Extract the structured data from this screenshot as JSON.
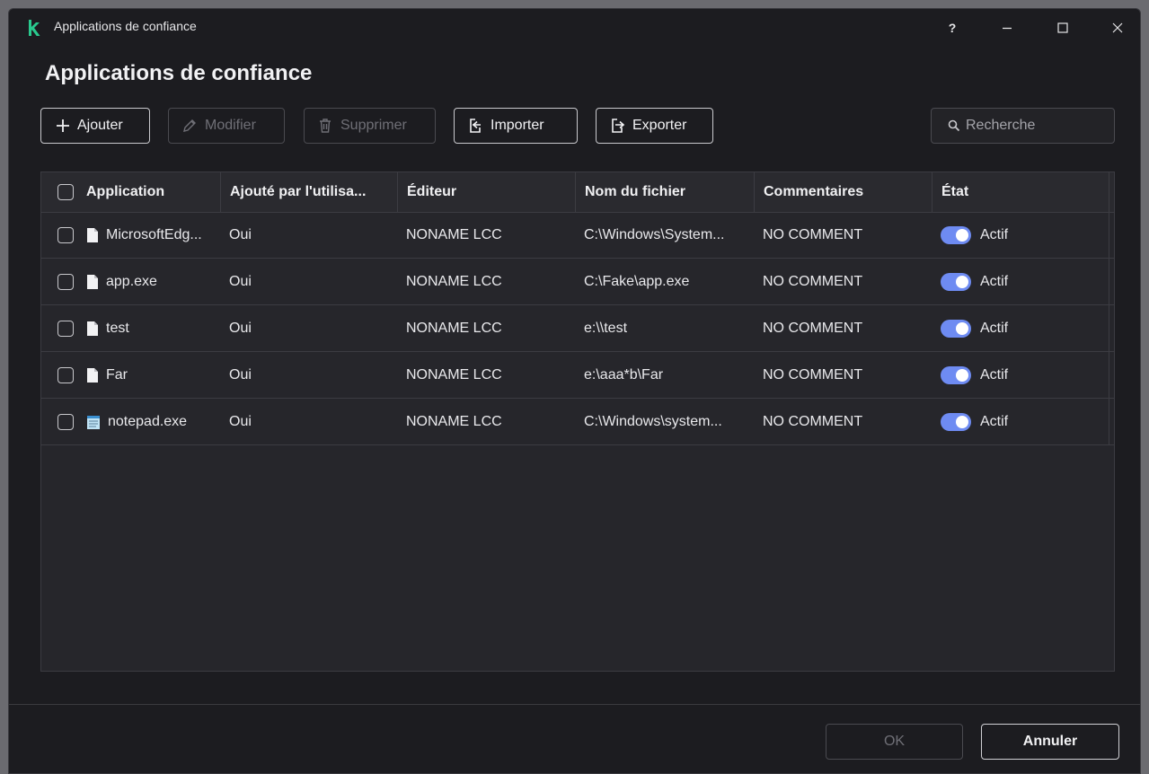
{
  "window": {
    "title": "Applications de confiance",
    "help": "?",
    "minimize": "—",
    "maximize": "☐",
    "close": "✕"
  },
  "page": {
    "title": "Applications de confiance"
  },
  "toolbar": {
    "add": "Ajouter",
    "edit": "Modifier",
    "delete": "Supprimer",
    "import": "Importer",
    "export": "Exporter",
    "search_placeholder": "Recherche"
  },
  "table": {
    "headers": [
      "Application",
      "Ajouté par l'utilisa...",
      "Éditeur",
      "Nom du fichier",
      "Commentaires",
      "État"
    ],
    "rows": [
      {
        "app": "MicrosoftEdg...",
        "added": "Oui",
        "publisher": "NONAME LCC",
        "file": "C:\\Windows\\System...",
        "comment": "NO COMMENT",
        "state": "Actif",
        "icon": "file-icon"
      },
      {
        "app": "app.exe",
        "added": "Oui",
        "publisher": "NONAME LCC",
        "file": "C:\\Fake\\app.exe",
        "comment": "NO COMMENT",
        "state": "Actif",
        "icon": "file-icon"
      },
      {
        "app": "test",
        "added": "Oui",
        "publisher": "NONAME LCC",
        "file": "e:\\\\test",
        "comment": "NO COMMENT",
        "state": "Actif",
        "icon": "file-icon"
      },
      {
        "app": "Far",
        "added": "Oui",
        "publisher": "NONAME LCC",
        "file": "e:\\aaa*b\\Far",
        "comment": "NO COMMENT",
        "state": "Actif",
        "icon": "file-icon"
      },
      {
        "app": "notepad.exe",
        "added": "Oui",
        "publisher": "NONAME LCC",
        "file": "C:\\Windows\\system...",
        "comment": "NO COMMENT",
        "state": "Actif",
        "icon": "notepad-icon"
      }
    ]
  },
  "footer": {
    "ok": "OK",
    "cancel": "Annuler"
  },
  "colors": {
    "accent_toggle": "#6e8bf2",
    "logo": "#29c98e",
    "background": "#1c1c20"
  }
}
